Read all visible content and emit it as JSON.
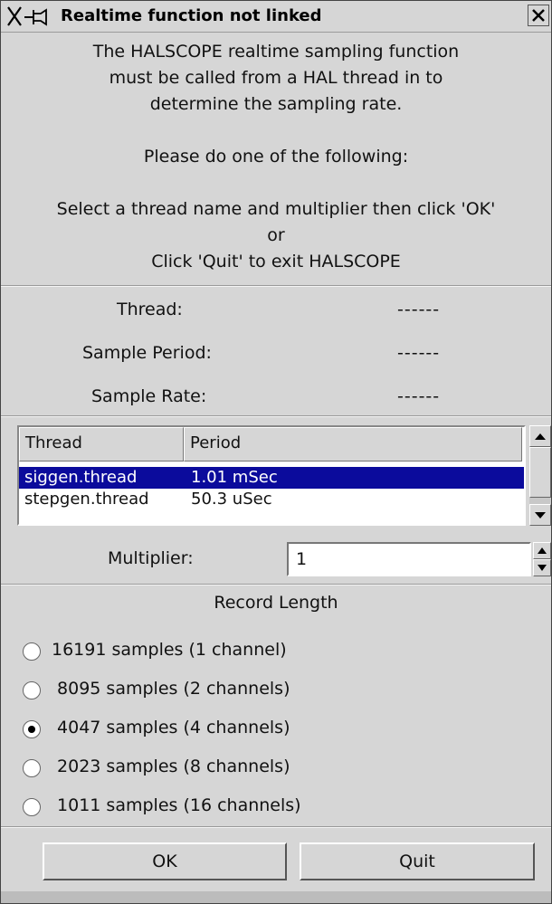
{
  "window": {
    "title": "Realtime function not linked"
  },
  "message": {
    "lines": [
      "The HALSCOPE realtime sampling function",
      "must be called from a HAL thread in to",
      "determine the sampling rate.",
      "",
      "Please do one of the following:",
      "",
      "Select a thread name and multiplier then click 'OK'",
      "or",
      "Click 'Quit' to exit HALSCOPE"
    ]
  },
  "info": {
    "thread_label": "Thread:",
    "thread_value": "------",
    "period_label": "Sample Period:",
    "period_value": "------",
    "rate_label": "Sample Rate:",
    "rate_value": "------"
  },
  "thread_list": {
    "columns": [
      "Thread",
      "Period"
    ],
    "rows": [
      {
        "thread": "siggen.thread",
        "period": "1.01 mSec",
        "selected": true
      },
      {
        "thread": "stepgen.thread",
        "period": "50.3 uSec",
        "selected": false
      }
    ]
  },
  "multiplier": {
    "label": "Multiplier:",
    "value": "1"
  },
  "record_length": {
    "title": "Record Length",
    "options": [
      {
        "label": "16191 samples (1 channel)",
        "selected": false
      },
      {
        "label": " 8095 samples (2 channels)",
        "selected": false
      },
      {
        "label": " 4047 samples (4 channels)",
        "selected": true
      },
      {
        "label": " 2023 samples (8 channels)",
        "selected": false
      },
      {
        "label": " 1011 samples (16 channels)",
        "selected": false
      }
    ]
  },
  "buttons": {
    "ok": "OK",
    "quit": "Quit"
  },
  "icons": {
    "window_menu": "window-menu-icon",
    "pin": "pin-icon",
    "close": "close-icon"
  },
  "colors": {
    "selection": "#0b0b9c",
    "background": "#d6d6d6"
  }
}
